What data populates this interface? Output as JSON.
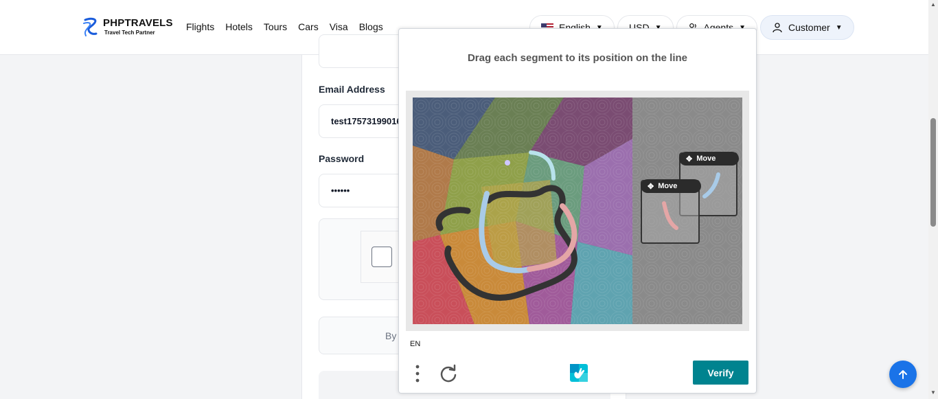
{
  "header": {
    "logo_title": "PHPTRAVELS",
    "logo_subtitle": "Travel Tech Partner",
    "nav": [
      "Flights",
      "Hotels",
      "Tours",
      "Cars",
      "Visa",
      "Blogs"
    ],
    "language": "English",
    "currency": "USD",
    "agents": "Agents",
    "customer": "Customer"
  },
  "form": {
    "email_label": "Email Address",
    "email_value": "test17573199016",
    "password_label": "Password",
    "password_value": "••••••",
    "terms_text_partial": "By"
  },
  "captcha": {
    "title": "Drag each segment to its position on the line",
    "move_label_1": "Move",
    "move_label_2": "Move",
    "language": "EN",
    "verify": "Verify"
  },
  "colors": {
    "brand_blue": "#1a73e8",
    "verify_teal": "#00838f"
  },
  "icons": [
    "phptravels-logo",
    "chevron-down-icon",
    "us-flag-icon",
    "agents-icon",
    "user-icon",
    "arrow-up-icon",
    "move-icon",
    "menu-dots-icon",
    "refresh-icon",
    "hcaptcha-logo"
  ]
}
